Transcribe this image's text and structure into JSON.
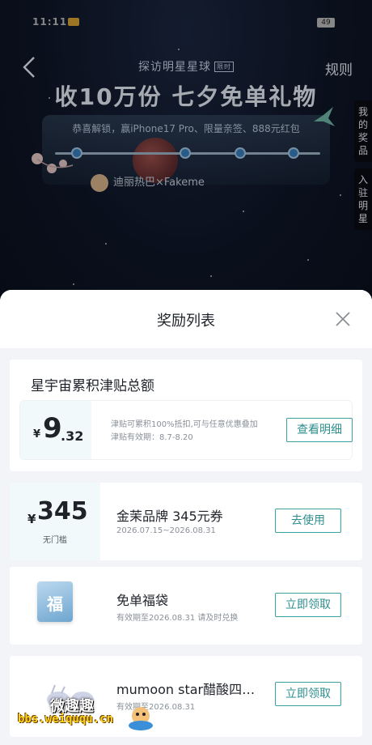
{
  "status_bar": {
    "time": "11:11",
    "battery": "49"
  },
  "background_page": {
    "subtitle": "探访明星星球",
    "subtitle_tag": "限时",
    "title": "收10万份 七夕免单礼物",
    "banner_text": "恭喜解锁，赢iPhone17 Pro、限量亲签、888元红包",
    "celebrity_text": "迪丽热巴×Fakeme",
    "rules_label": "规则",
    "side_tab_prizes": "我的奖品",
    "side_tab_join": "入驻明星"
  },
  "sheet": {
    "title": "奖励列表",
    "total_card": {
      "title": "星宇宙累积津贴总额",
      "currency": "¥",
      "amount_int": "9",
      "amount_dec": ".32",
      "desc_line1": "津贴可累积100%抵扣,可与任意优惠叠加",
      "desc_line2": "津贴有效期：8.7-8.20",
      "button_label": "查看明细"
    },
    "rewards": [
      {
        "currency": "¥",
        "value": "345",
        "condition": "无门槛",
        "name": "金茉品牌 345元券",
        "date": "2026.07.15~2026.08.31",
        "button_label": "去使用"
      },
      {
        "image_text": "福",
        "name": "免单福袋",
        "date": "有效期至2026.08.31 请及时兑换",
        "button_label": "立即领取"
      },
      {
        "name": "mumoon star醋酸四…",
        "date": "有效期至2026.08.31",
        "button_label": "立即领取"
      }
    ]
  },
  "watermark": {
    "text": "微趣趣",
    "url": "bbs.weiququ.cn"
  },
  "colors": {
    "accent": "#2f8e8e",
    "sheet_bg": "#f2f4f7",
    "coupon_bg": "#f1f9fb"
  }
}
